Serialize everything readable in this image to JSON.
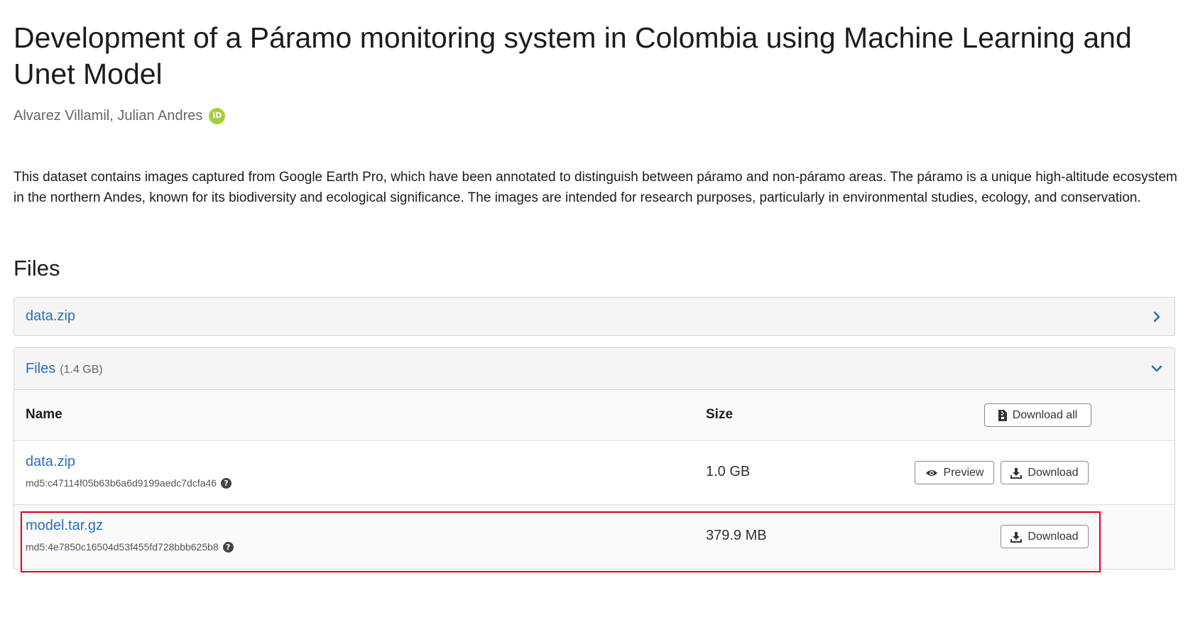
{
  "record": {
    "title": "Development of a Páramo monitoring system in Colombia using Machine Learning and Unet Model",
    "author": "Alvarez Villamil, Julian Andres",
    "orcid_label": "iD",
    "description": "This dataset contains images captured from Google Earth Pro, which have been annotated to distinguish between páramo and non-páramo areas. The páramo is a unique high-altitude ecosystem in the northern Andes, known for its biodiversity and ecological significance. The images are intended for research purposes, particularly in environmental studies, ecology, and conservation."
  },
  "files_section": {
    "heading": "Files",
    "preview_panel": {
      "label": "data.zip",
      "icon": "chevron-right-icon"
    },
    "files_panel": {
      "label": "Files",
      "total_size": "(1.4 GB)",
      "icon": "chevron-down-icon",
      "columns": {
        "name": "Name",
        "size": "Size"
      },
      "download_all_label": "Download all",
      "rows": [
        {
          "name": "data.zip",
          "md5": "md5:c47114f05b63b6a6d9199aedc7dcfa46",
          "size": "1.0 GB",
          "preview_label": "Preview",
          "download_label": "Download"
        },
        {
          "name": "model.tar.gz",
          "md5": "md5:4e7850c16504d53f455fd728bbb625b8",
          "size": "379.9 MB",
          "download_label": "Download"
        }
      ]
    }
  },
  "colors": {
    "link": "#2a6ebb",
    "orcid": "#a6ce39",
    "highlight": "#e0001a",
    "panel_bg": "#f5f5f5"
  }
}
